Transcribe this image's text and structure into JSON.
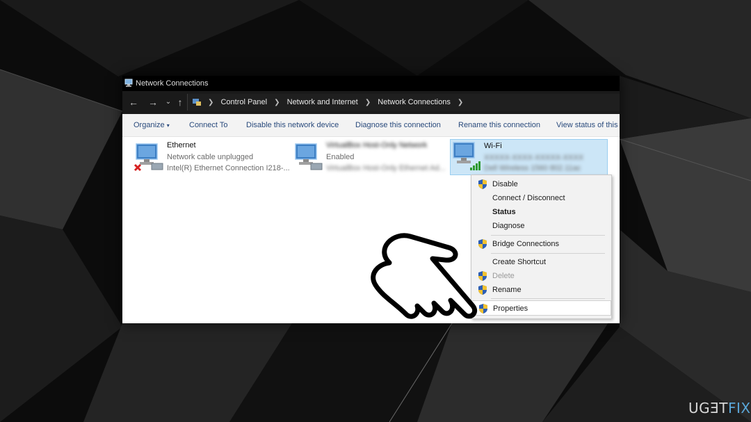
{
  "window": {
    "title": "Network Connections"
  },
  "addressbar": {
    "breadcrumbs": [
      "Control Panel",
      "Network and Internet",
      "Network Connections"
    ]
  },
  "toolbar": {
    "organize": "Organize",
    "organize_arrow": "▾",
    "items": [
      "Connect To",
      "Disable this network device",
      "Diagnose this connection",
      "Rename this connection",
      "View status of this"
    ]
  },
  "connections": [
    {
      "name": "Ethernet",
      "status": "Network cable unplugged",
      "device": "Intel(R) Ethernet Connection I218-...",
      "blurred": false,
      "selected": false
    },
    {
      "name": "VirtualBox Host-Only Network",
      "status": "Enabled",
      "device": "VirtualBox Host-Only Ethernet Ad...",
      "blurred": true,
      "selected": false
    },
    {
      "name": "Wi-Fi",
      "status": "XXXXX-XXXX-XXXXX-XXXX",
      "device": "Dell Wireless 1560 802.11ac",
      "blurred": true,
      "selected": true
    }
  ],
  "context_menu": {
    "items": [
      {
        "label": "Disable",
        "shield": true
      },
      {
        "label": "Connect / Disconnect",
        "shield": false
      },
      {
        "label": "Status",
        "shield": false,
        "bold": true
      },
      {
        "label": "Diagnose",
        "shield": false
      },
      {
        "label": "Bridge Connections",
        "shield": true
      },
      {
        "label": "Create Shortcut",
        "shield": false
      },
      {
        "label": "Delete",
        "shield": true,
        "disabled": true
      },
      {
        "label": "Rename",
        "shield": true
      },
      {
        "label": "Properties",
        "shield": true,
        "highlighted": true
      }
    ]
  },
  "watermark": {
    "prefix": "UG",
    "glyph": "Ǝ",
    "mid": "T",
    "suffix": "FIX"
  },
  "colors": {
    "accent_toolbar_text": "#294a7c",
    "selection_bg": "#cce6f7",
    "logo_fix": "#5aa6d8"
  },
  "icons": {
    "back": "arrow-left-icon",
    "forward": "arrow-right-icon",
    "recent": "chevron-down-icon",
    "up": "arrow-up-icon",
    "shield": "uac-shield-icon",
    "pointer": "hand-pointer-icon"
  }
}
